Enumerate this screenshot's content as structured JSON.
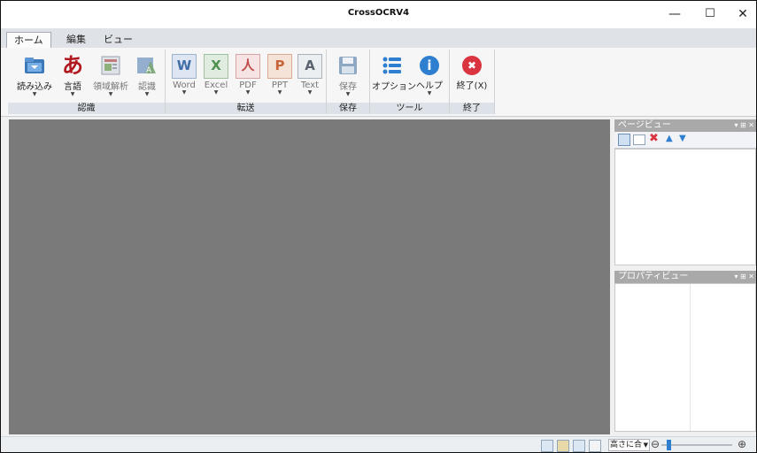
{
  "window": {
    "title": "CrossOCRV4",
    "minimize_label": "—",
    "maximize_label": "☐",
    "close_label": "✕"
  },
  "tabs": [
    {
      "label": "ホーム",
      "active": true
    },
    {
      "label": "編集",
      "active": false
    },
    {
      "label": "ビュー",
      "active": false
    }
  ],
  "ribbon": {
    "groups": {
      "recognize": {
        "title": "認識",
        "buttons": [
          {
            "label": "読み込み",
            "icon": "folder-import-icon",
            "enabled": true,
            "dropdown": true
          },
          {
            "label": "言語",
            "icon": "hiragana-a-icon",
            "enabled": true,
            "dropdown": true
          },
          {
            "label": "領域解析",
            "icon": "layout-analysis-icon",
            "enabled": false,
            "dropdown": true
          },
          {
            "label": "認識",
            "icon": "recognize-icon",
            "enabled": false,
            "dropdown": true
          }
        ]
      },
      "transfer": {
        "title": "転送",
        "buttons": [
          {
            "label": "Word",
            "icon": "word-icon",
            "letter": "W",
            "enabled": false,
            "dropdown": true
          },
          {
            "label": "Excel",
            "icon": "excel-icon",
            "letter": "X",
            "enabled": false,
            "dropdown": true
          },
          {
            "label": "PDF",
            "icon": "pdf-icon",
            "letter": "人",
            "enabled": false,
            "dropdown": true
          },
          {
            "label": "PPT",
            "icon": "ppt-icon",
            "letter": "P",
            "enabled": false,
            "dropdown": true
          },
          {
            "label": "Text",
            "icon": "text-icon",
            "letter": "A",
            "enabled": false,
            "dropdown": true
          }
        ]
      },
      "save": {
        "title": "保存",
        "buttons": [
          {
            "label": "保存",
            "icon": "floppy-disk-icon",
            "enabled": false,
            "dropdown": true
          }
        ]
      },
      "tools": {
        "title": "ツール",
        "buttons": [
          {
            "label": "オプション",
            "icon": "options-list-icon",
            "enabled": true,
            "dropdown": false
          },
          {
            "label": "ヘルプ",
            "icon": "info-icon",
            "letter": "i",
            "enabled": true,
            "dropdown": true
          }
        ]
      },
      "exit": {
        "title": "終了",
        "buttons": [
          {
            "label": "終了(X)",
            "icon": "exit-icon",
            "letter": "✖",
            "enabled": true,
            "dropdown": false
          }
        ]
      }
    }
  },
  "page_view": {
    "title": "ページビュー",
    "controls": "▾ ⊞ ✕"
  },
  "property_view": {
    "title": "プロパティビュー",
    "controls": "▾ ⊞ ✕"
  },
  "status": {
    "zoom_mode": "高さに合",
    "zoom_out": "⊖",
    "zoom_in": "⊕"
  },
  "colors": {
    "canvas": "#7a7a7a",
    "panel_header": "#a9a9a9",
    "accent_blue": "#2f7fd0",
    "exit_red": "#d9343f"
  }
}
